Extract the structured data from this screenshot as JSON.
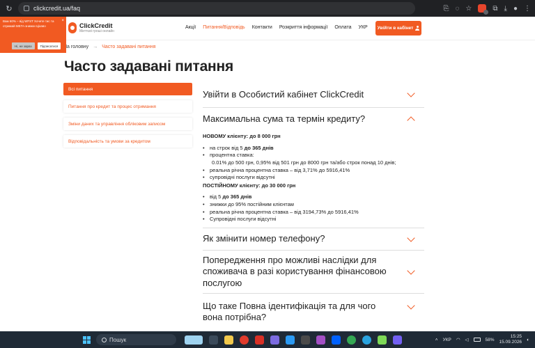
{
  "browser": {
    "url": "clickcredit.ua/faq"
  },
  "popup": {
    "text": "Вам 60% – від WFST  Хочете тис та отримай МЕГА-знижки Цікаво",
    "close": "×",
    "no_label": "Ні, не зараз",
    "yes_label": "Підписатися"
  },
  "header": {
    "logo_name": "ClickCredit",
    "logo_tagline": "Миттєві гроші онлайн",
    "nav": [
      "Акції",
      "Питання/Відповідь",
      "Контакти",
      "Розкриття інформації",
      "Оплата",
      "УКР"
    ],
    "cabinet_label": "Увійти в кабінет"
  },
  "breadcrumb": {
    "home": "На головну",
    "separator": "→",
    "current": "Часто задавані питання"
  },
  "page": {
    "title": "Часто задавані питання"
  },
  "sidebar": {
    "items": [
      {
        "label": "Всі питання",
        "active": true
      },
      {
        "label": "Питання про кредит та процес отримання",
        "active": false
      },
      {
        "label": "Зміни даних та управління обліковим записом",
        "active": false
      },
      {
        "label": "Відповідальність та умови за кредитом",
        "active": false
      }
    ]
  },
  "faq": {
    "q1": "Увійти в Особистий кабінет ClickCredit",
    "q2": "Максимальна сума та термін кредиту?",
    "q2_answer": {
      "new_client": "НОВОМУ клієнту: до 8 000 грн",
      "new_term_prefix": "на строк від 5 ",
      "new_term_bold": "до 365 днів",
      "rate_label": "процентна ставка:",
      "rate_value": "0.01% до 500 грн, 0,95% від 501 грн до 8000 грн та/або строк понад 10 днів;",
      "real_rate_new": "реальна річна процентна ставка – від 3,71% до 5916,41%",
      "services_new": "супровідні послуги відсутні",
      "regular_client": "ПОСТІЙНОМУ клієнту: до 30 000 грн",
      "regular_term_prefix": "від 5 ",
      "regular_term_bold": "до 365 днів",
      "discounts": "знижки до 95% постійним клієнтам",
      "real_rate_regular": "реальна річна процентна ставка – від 3194,73% до 5916,41%",
      "services_regular": "Супровідні послуги відсутні"
    },
    "q3": "Як змінити номер телефону?",
    "q4": "Попередження про можливі наслідки для споживача в разі користування фінансовою послугою",
    "q5": "Що таке Повна ідентифікація та для чого вона потрібна?"
  },
  "taskbar": {
    "search_label": "Пошук",
    "lang": "УКР",
    "battery": "58%",
    "time": "15:25",
    "date": "15.09.2026"
  },
  "colors": {
    "accent": "#f15a22",
    "text": "#222222",
    "taskbar": "#1f2a36"
  }
}
